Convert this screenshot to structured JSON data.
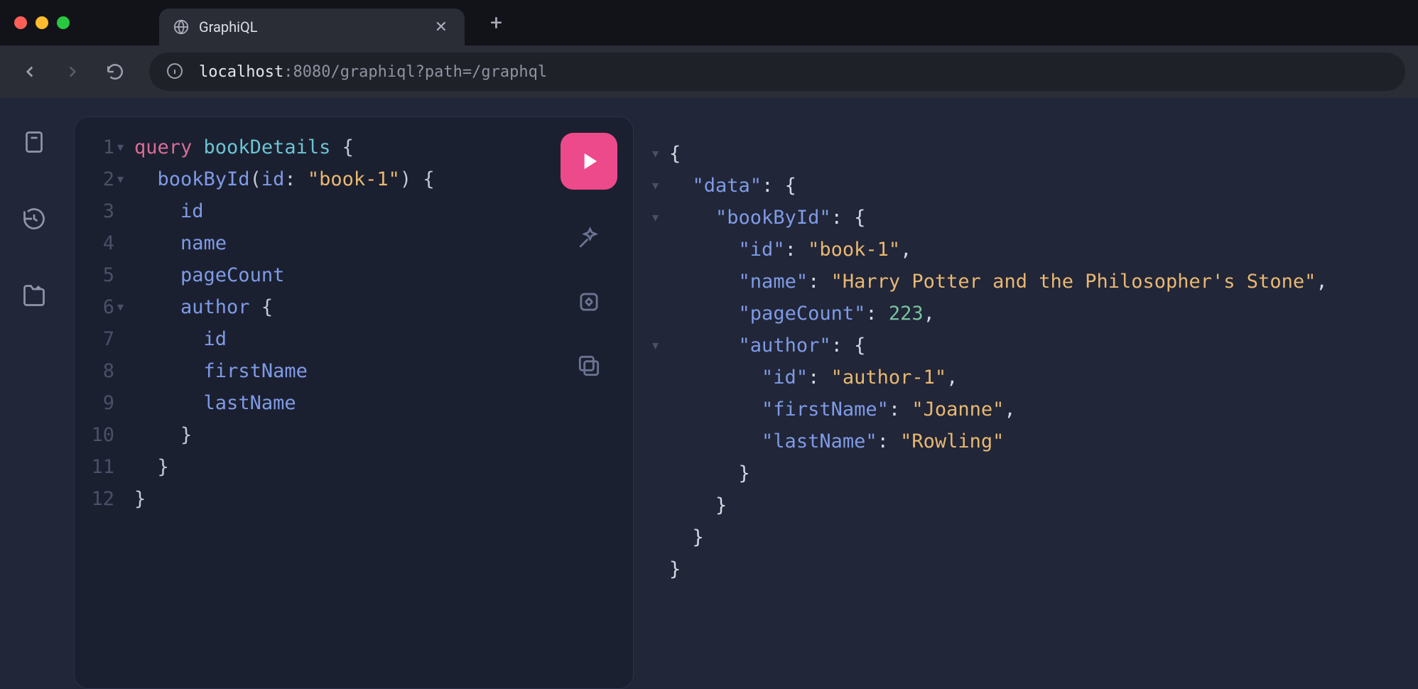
{
  "browser": {
    "tab_title": "GraphiQL",
    "url_host": "localhost",
    "url_port_path": ":8080/graphiql?path=/graphql"
  },
  "editor": {
    "lines": [
      {
        "n": "1",
        "fold": true,
        "tokens": [
          [
            "k-query",
            "query"
          ],
          [
            "k-punc",
            " "
          ],
          [
            "k-name",
            "bookDetails"
          ],
          [
            "k-punc",
            " {"
          ]
        ]
      },
      {
        "n": "2",
        "fold": true,
        "tokens": [
          [
            "k-punc",
            "  "
          ],
          [
            "k-field",
            "bookById"
          ],
          [
            "k-punc",
            "("
          ],
          [
            "k-arg",
            "id"
          ],
          [
            "k-punc",
            ": "
          ],
          [
            "k-str",
            "\"book-1\""
          ],
          [
            "k-punc",
            ") {"
          ]
        ]
      },
      {
        "n": "3",
        "fold": false,
        "tokens": [
          [
            "k-punc",
            "    "
          ],
          [
            "k-field",
            "id"
          ]
        ]
      },
      {
        "n": "4",
        "fold": false,
        "tokens": [
          [
            "k-punc",
            "    "
          ],
          [
            "k-field",
            "name"
          ]
        ]
      },
      {
        "n": "5",
        "fold": false,
        "tokens": [
          [
            "k-punc",
            "    "
          ],
          [
            "k-field",
            "pageCount"
          ]
        ]
      },
      {
        "n": "6",
        "fold": true,
        "tokens": [
          [
            "k-punc",
            "    "
          ],
          [
            "k-field",
            "author"
          ],
          [
            "k-punc",
            " {"
          ]
        ]
      },
      {
        "n": "7",
        "fold": false,
        "tokens": [
          [
            "k-punc",
            "      "
          ],
          [
            "k-field",
            "id"
          ]
        ]
      },
      {
        "n": "8",
        "fold": false,
        "tokens": [
          [
            "k-punc",
            "      "
          ],
          [
            "k-field",
            "firstName"
          ]
        ]
      },
      {
        "n": "9",
        "fold": false,
        "tokens": [
          [
            "k-punc",
            "      "
          ],
          [
            "k-field",
            "lastName"
          ]
        ]
      },
      {
        "n": "10",
        "fold": false,
        "tokens": [
          [
            "k-punc",
            "    }"
          ]
        ]
      },
      {
        "n": "11",
        "fold": false,
        "tokens": [
          [
            "k-punc",
            "  }"
          ]
        ]
      },
      {
        "n": "12",
        "fold": false,
        "tokens": [
          [
            "k-punc",
            "}"
          ]
        ]
      }
    ]
  },
  "result": {
    "lines": [
      {
        "fold": true,
        "tokens": [
          [
            "k-white",
            "{"
          ]
        ]
      },
      {
        "fold": true,
        "tokens": [
          [
            "k-white",
            "  "
          ],
          [
            "k-key",
            "\"data\""
          ],
          [
            "k-white",
            ": {"
          ]
        ]
      },
      {
        "fold": true,
        "tokens": [
          [
            "k-white",
            "    "
          ],
          [
            "k-key",
            "\"bookById\""
          ],
          [
            "k-white",
            ": {"
          ]
        ]
      },
      {
        "fold": false,
        "tokens": [
          [
            "k-white",
            "      "
          ],
          [
            "k-key",
            "\"id\""
          ],
          [
            "k-white",
            ": "
          ],
          [
            "k-str",
            "\"book-1\""
          ],
          [
            "k-white",
            ","
          ]
        ]
      },
      {
        "fold": false,
        "tokens": [
          [
            "k-white",
            "      "
          ],
          [
            "k-key",
            "\"name\""
          ],
          [
            "k-white",
            ": "
          ],
          [
            "k-str",
            "\"Harry Potter and the Philosopher's Stone\""
          ],
          [
            "k-white",
            ","
          ]
        ]
      },
      {
        "fold": false,
        "tokens": [
          [
            "k-white",
            "      "
          ],
          [
            "k-key",
            "\"pageCount\""
          ],
          [
            "k-white",
            ": "
          ],
          [
            "k-num",
            "223"
          ],
          [
            "k-white",
            ","
          ]
        ]
      },
      {
        "fold": true,
        "tokens": [
          [
            "k-white",
            "      "
          ],
          [
            "k-key",
            "\"author\""
          ],
          [
            "k-white",
            ": {"
          ]
        ]
      },
      {
        "fold": false,
        "tokens": [
          [
            "k-white",
            "        "
          ],
          [
            "k-key",
            "\"id\""
          ],
          [
            "k-white",
            ": "
          ],
          [
            "k-str",
            "\"author-1\""
          ],
          [
            "k-white",
            ","
          ]
        ]
      },
      {
        "fold": false,
        "tokens": [
          [
            "k-white",
            "        "
          ],
          [
            "k-key",
            "\"firstName\""
          ],
          [
            "k-white",
            ": "
          ],
          [
            "k-str",
            "\"Joanne\""
          ],
          [
            "k-white",
            ","
          ]
        ]
      },
      {
        "fold": false,
        "tokens": [
          [
            "k-white",
            "        "
          ],
          [
            "k-key",
            "\"lastName\""
          ],
          [
            "k-white",
            ": "
          ],
          [
            "k-str",
            "\"Rowling\""
          ]
        ]
      },
      {
        "fold": false,
        "tokens": [
          [
            "k-white",
            "      }"
          ]
        ]
      },
      {
        "fold": false,
        "tokens": [
          [
            "k-white",
            "    }"
          ]
        ]
      },
      {
        "fold": false,
        "tokens": [
          [
            "k-white",
            "  }"
          ]
        ]
      },
      {
        "fold": false,
        "tokens": [
          [
            "k-white",
            "}"
          ]
        ]
      }
    ]
  }
}
